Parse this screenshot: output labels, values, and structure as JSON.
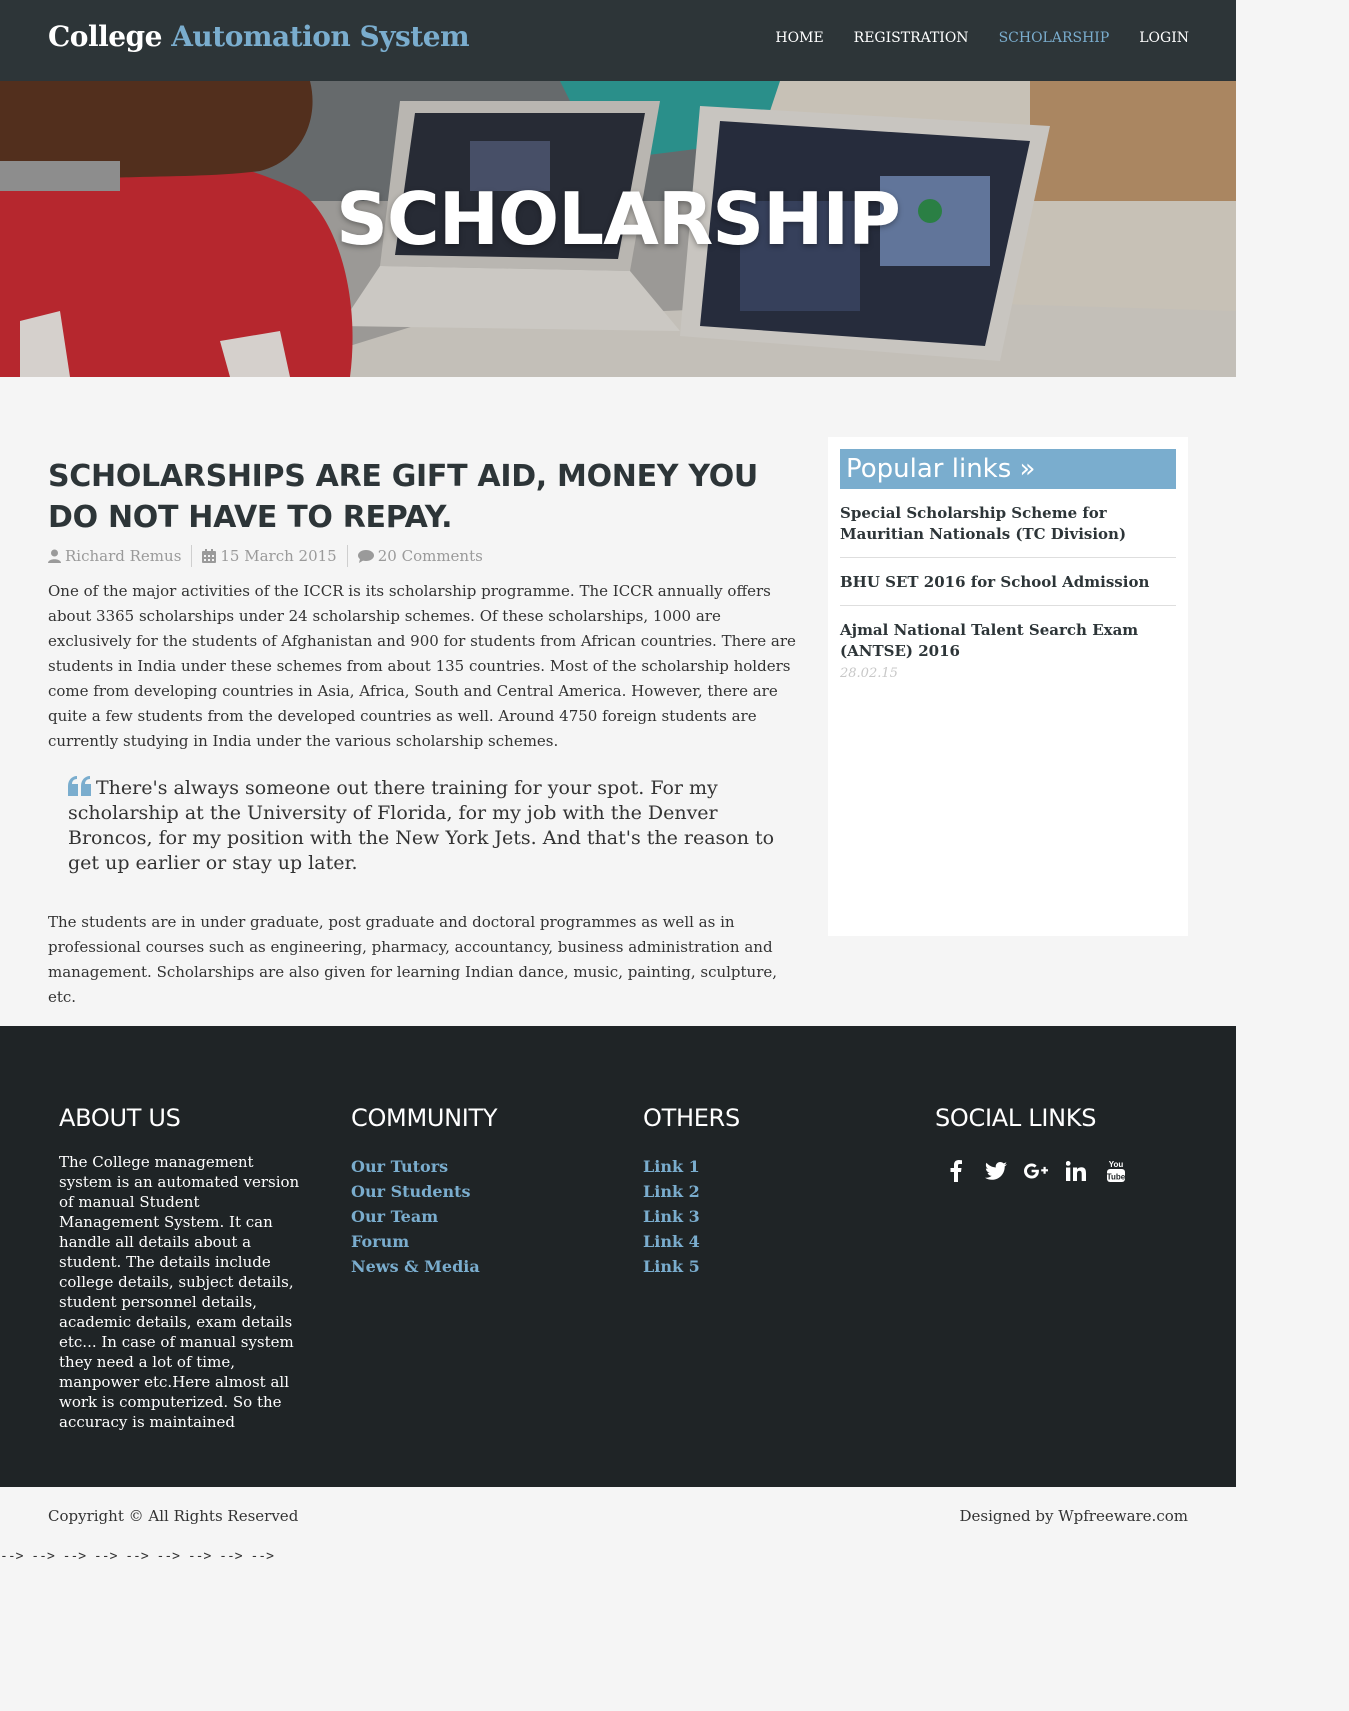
{
  "header": {
    "brand_main": "College",
    "brand_accent": "Automation System",
    "nav": [
      {
        "label": "HOME",
        "active": false
      },
      {
        "label": "REGISTRATION",
        "active": false
      },
      {
        "label": "SCHOLARSHIP",
        "active": true
      },
      {
        "label": "LOGIN",
        "active": false
      }
    ]
  },
  "hero": {
    "title": "SCHOLARSHIP"
  },
  "article": {
    "title": "SCHOLARSHIPS ARE GIFT AID, MONEY YOU DO NOT HAVE TO REPAY.",
    "author": "Richard Remus",
    "date": "15 March 2015",
    "comments": "20 Comments",
    "paragraph1": "One of the major activities of the ICCR is its scholarship programme. The ICCR annually offers about 3365 scholarships under 24 scholarship schemes. Of these scholarships, 1000 are exclusively for the students of Afghanistan and 900 for students from African countries. There are students in India under these schemes from about 135 countries. Most of the scholarship holders come from developing countries in Asia, Africa, South and Central America. However, there are quite a few students from the developed countries as well. Around 4750 foreign students are currently studying in India under the various scholarship schemes.",
    "quote": "There's always someone out there training for your spot. For my scholarship at the University of Florida, for my job with the Denver Broncos, for my position with the New York Jets. And that's the reason to get up earlier or stay up later.",
    "paragraph2": "The students are in under graduate, post graduate and doctoral programmes as well as in professional courses such as engineering, pharmacy, accountancy, business administration and management. Scholarships are also given for learning Indian dance, music, painting, sculpture, etc."
  },
  "sidebar": {
    "heading": "Popular links »",
    "links": [
      {
        "title": "Special Scholarship Scheme for Mauritian Nationals (TC Division)",
        "date": ""
      },
      {
        "title": "BHU SET 2016 for School Admission",
        "date": ""
      },
      {
        "title": "Ajmal National Talent Search Exam (ANTSE) 2016",
        "date": "28.02.15"
      }
    ]
  },
  "footer": {
    "about_heading": "ABOUT US",
    "about_text": "The College management system is an automated version of manual Student Management System. It can handle all details about a student. The details include college details, subject details, student personnel details, academic details, exam details etc... In case of manual system they need a lot of time, manpower etc.Here almost all work is computerized. So the accuracy is maintained",
    "community_heading": "COMMUNITY",
    "community_links": [
      "Our Tutors",
      "Our Students",
      "Our Team",
      "Forum",
      "News & Media"
    ],
    "others_heading": "OTHERS",
    "others_links": [
      "Link 1",
      "Link 2",
      "Link 3",
      "Link 4",
      "Link 5"
    ],
    "social_heading": "SOCIAL LINKS",
    "social_icons": [
      "facebook-icon",
      "twitter-icon",
      "google-plus-icon",
      "linkedin-icon",
      "youtube-icon"
    ]
  },
  "bottom": {
    "copyright": "Copyright © All Rights Reserved",
    "designed_by": "Designed by Wpfreeware.com",
    "trailer": "--> --> --> --> --> --> --> --> -->"
  },
  "colors": {
    "accent": "#7aadce",
    "header_bg": "#2d3538",
    "footer_bg": "#1f2426"
  }
}
